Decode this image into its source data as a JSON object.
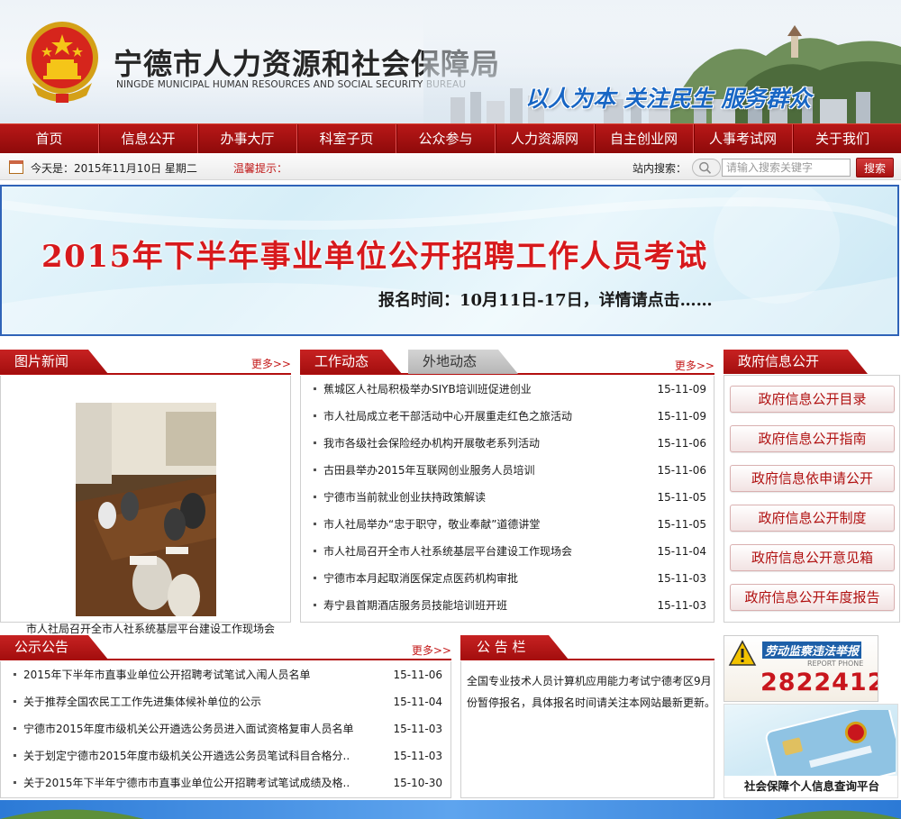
{
  "header": {
    "title": "宁德市人力资源和社会保障局",
    "subtitle": "NINGDE MUNICIPAL HUMAN RESOURCES AND SOCIAL SECURITY BUREAU",
    "slogan": "以人为本  关注民生  服务群众"
  },
  "nav": {
    "items": [
      "首页",
      "信息公开",
      "办事大厅",
      "科室子页",
      "公众参与",
      "人力资源网",
      "自主创业网",
      "人事考试网",
      "关于我们"
    ]
  },
  "infobar": {
    "date_text": "今天是：2015年11月10日 星期二",
    "tip_label": "温馨提示：",
    "search_label": "站内搜索：",
    "search_placeholder": "请输入搜索关键字",
    "search_button": "搜索"
  },
  "banner": {
    "title": "2015年下半年事业单位公开招聘工作人员考试",
    "subtitle": "报名时间：10月11日-17日，详情请点击……"
  },
  "photo_news": {
    "tab": "图片新闻",
    "more": "更多>>",
    "caption": "市人社局召开全市人社系统基层平台建设工作现场会"
  },
  "work_news": {
    "tab_active": "工作动态",
    "tab_inactive": "外地动态",
    "more": "更多>>",
    "items": [
      {
        "title": "蕉城区人社局积极举办SIYB培训班促进创业",
        "date": "15-11-09"
      },
      {
        "title": "市人社局成立老干部活动中心开展重走红色之旅活动",
        "date": "15-11-09"
      },
      {
        "title": "我市各级社会保险经办机构开展敬老系列活动",
        "date": "15-11-06"
      },
      {
        "title": "古田县举办2015年互联网创业服务人员培训",
        "date": "15-11-06"
      },
      {
        "title": "宁德市当前就业创业扶持政策解读",
        "date": "15-11-05"
      },
      {
        "title": "市人社局举办“忠于职守，敬业奉献”道德讲堂",
        "date": "15-11-05"
      },
      {
        "title": "市人社局召开全市人社系统基层平台建设工作现场会",
        "date": "15-11-04"
      },
      {
        "title": "宁德市本月起取消医保定点医药机构审批",
        "date": "15-11-03"
      },
      {
        "title": "寿宁县首期酒店服务员技能培训班开班",
        "date": "15-11-03"
      }
    ]
  },
  "gov_info": {
    "tab": "政府信息公开",
    "buttons": [
      "政府信息公开目录",
      "政府信息公开指南",
      "政府信息依申请公开",
      "政府信息公开制度",
      "政府信息公开意见箱",
      "政府信息公开年度报告"
    ]
  },
  "announcements": {
    "tab": "公示公告",
    "more": "更多>>",
    "items": [
      {
        "title": "2015年下半年市直事业单位公开招聘考试笔试入闱人员名单",
        "date": "15-11-06"
      },
      {
        "title": "关于推荐全国农民工工作先进集体候补单位的公示",
        "date": "15-11-04"
      },
      {
        "title": "宁德市2015年度市级机关公开遴选公务员进入面试资格复审人员名单",
        "date": "15-11-03"
      },
      {
        "title": "关于划定宁德市2015年度市级机关公开遴选公务员笔试科目合格分..",
        "date": "15-11-03"
      },
      {
        "title": "关于2015年下半年宁德市市直事业单位公开招聘考试笔试成绩及格..",
        "date": "15-10-30"
      }
    ]
  },
  "notice_board": {
    "tab": "公 告 栏",
    "text": "全国专业技术人员计算机应用能力考试宁德考区9月份暂停报名，具体报名时间请关注本网站最新更新。"
  },
  "ads": {
    "report_title": "劳动监察违法举报",
    "report_en": "REPORT PHONE",
    "report_phone": "2822412",
    "card_caption": "社会保障个人信息查询平台"
  }
}
